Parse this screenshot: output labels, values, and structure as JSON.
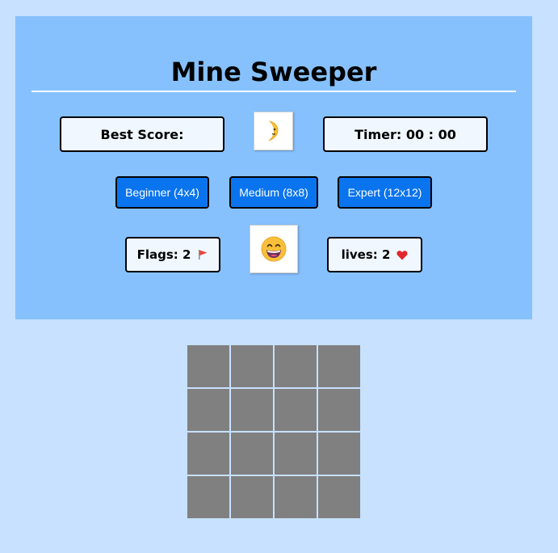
{
  "header": {
    "title": "Mine Sweeper"
  },
  "stats": {
    "best_score_label": "Best Score:",
    "timer_label": "Timer: 00 : 00",
    "flags_label": "Flags: 2",
    "lives_label": "lives: 2"
  },
  "levels": [
    {
      "label": "Beginner (4x4)"
    },
    {
      "label": "Medium (8x8)"
    },
    {
      "label": "Expert (12x12)"
    }
  ],
  "icons": {
    "theme_toggle": "crescent-moon-face-icon",
    "face": "grinning-face-icon",
    "flag": "red-flag-icon",
    "heart": "red-heart-icon"
  },
  "board": {
    "rows": 4,
    "cols": 4,
    "cell_state": "hidden"
  },
  "colors": {
    "page_background": "#c7e1ff",
    "panel_background": "#86c1fd",
    "button_blue": "#0a74ee",
    "cell_hidden": "#808080",
    "info_box_background": "#f0f7ff"
  }
}
